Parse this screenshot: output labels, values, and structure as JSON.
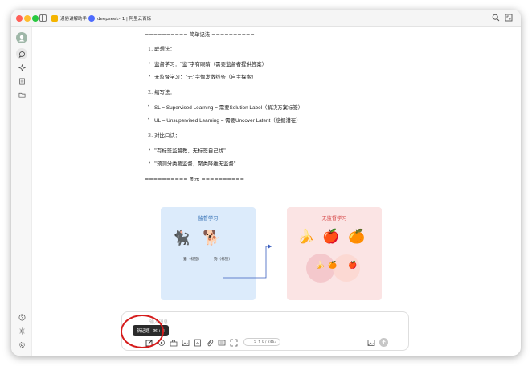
{
  "tabs": [
    {
      "label": "通俗讲解助手",
      "icon": "assistant-emoji-icon"
    },
    {
      "label": "deepseek-r1 | 阿里云百炼",
      "icon": "deepseek-whale-icon"
    }
  ],
  "content": {
    "section_simple": "========== 简单记法 ==========",
    "memory_heading_1_num": "1.",
    "memory_heading_1": "联想法：",
    "bullet_1": "监督学习：\"监\"字有眼睛（需要监督者提供答案）",
    "bullet_2": "无监督学习：\"无\"字像发散线条（自主探索）",
    "memory_heading_2_num": "2.",
    "memory_heading_2": "缩写法：",
    "bullet_3": "SL = Supervised Learning = 需要Solution Label（解决方案标签）",
    "bullet_4": "UL = Unsupervised Learning = 需要Uncover Latent（挖掘潜在）",
    "memory_heading_3_num": "3.",
    "memory_heading_3": "对比口诀：",
    "bullet_5": "\"有标签监督教，无标签自己找\"",
    "bullet_6": "\"预测分类要监督，聚类降维无监督\"",
    "section_diagram": "========== 图示 =========="
  },
  "diagram": {
    "left_title": "监督学习",
    "right_title": "无监督学习",
    "cat_label": "猫（标签）",
    "dog_label": "狗（标签）",
    "cat_emoji": "🐈‍⬛",
    "dog_emoji": "🐕",
    "fruit_top": [
      "🍌",
      "🍎",
      "🍊"
    ],
    "fruit_cluster": [
      "🍌",
      "🍊",
      "🍎"
    ]
  },
  "composer": {
    "placeholder": "输入消息...",
    "tooltip_label": "新话题",
    "tooltip_shortcut": "⌘+N",
    "token_count": "5",
    "token_usage": "↑ 0 / 2463"
  },
  "colors": {
    "accent_red": "#d61c1c",
    "supervised_blue": "#2f6db3",
    "unsupervised_red": "#d64545"
  }
}
